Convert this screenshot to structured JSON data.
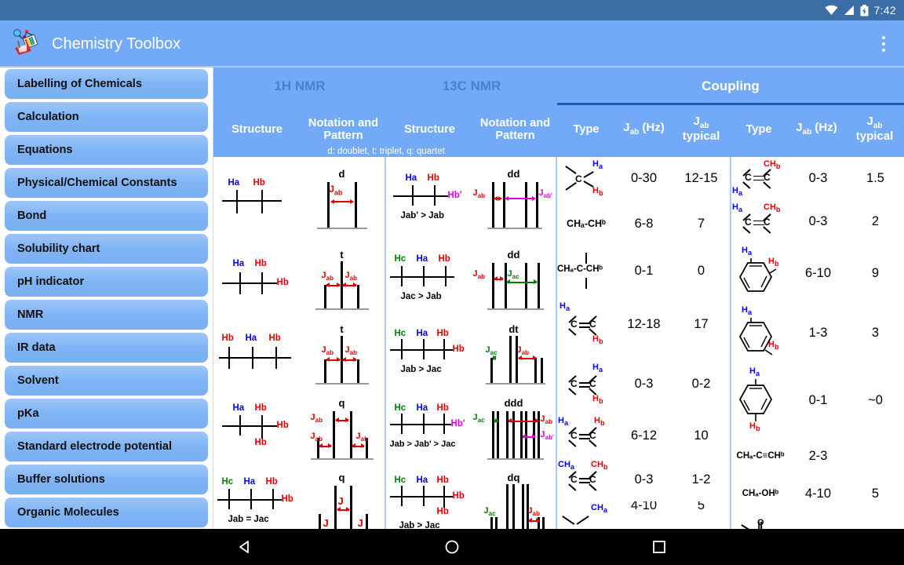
{
  "status_bar": {
    "time": "7:42",
    "icons": [
      "wifi-icon",
      "signal-icon",
      "battery-charging-icon"
    ]
  },
  "app_bar": {
    "title": "Chemistry Toolbox",
    "logo": "chemistry-toolbox-logo",
    "overflow": "overflow-menu-icon"
  },
  "sidebar": {
    "items": [
      {
        "label": "Labelling of Chemicals"
      },
      {
        "label": "Calculation"
      },
      {
        "label": "Equations"
      },
      {
        "label": "Physical/Chemical Constants"
      },
      {
        "label": "Bond"
      },
      {
        "label": "Solubility chart"
      },
      {
        "label": "pH indicator"
      },
      {
        "label": "NMR"
      },
      {
        "label": "IR data"
      },
      {
        "label": "Solvent"
      },
      {
        "label": "pKa"
      },
      {
        "label": "Standard electrode potential"
      },
      {
        "label": "Buffer solutions"
      },
      {
        "label": "Organic Molecules"
      }
    ]
  },
  "tabs": [
    {
      "label": "1H NMR",
      "active": false
    },
    {
      "label": "13C NMR",
      "active": false
    },
    {
      "label": "Coupling",
      "active": true
    }
  ],
  "column_headers": {
    "structure1": "Structure",
    "pattern1_line1": "Notation and",
    "pattern1_line2": "Pattern",
    "structure2": "Structure",
    "pattern2_line1": "Notation and",
    "pattern2_line2": "Pattern",
    "type1": "Type",
    "hz1": "J",
    "hz1_sub": "ab",
    "hz1_unit": " (Hz)",
    "typ1_line1": "J",
    "typ1_sub": "ab",
    "typ1_line2": "typical",
    "type2": "Type",
    "hz2": "J",
    "hz2_sub": "ab",
    "hz2_unit": " (Hz)",
    "typ2_line1": "J",
    "typ2_sub": "ab",
    "typ2_line2": "typical",
    "legend": "d: doublet, t: triplet, q: quartet"
  },
  "nmr_1h_rows": [
    {
      "labels": [
        "Ha",
        "Hb"
      ],
      "extra": "",
      "notation": "d"
    },
    {
      "labels": [
        "Ha",
        "Hb",
        "Hb"
      ],
      "extra": "",
      "notation": "t"
    },
    {
      "labels": [
        "Hb",
        "Ha",
        "Hb"
      ],
      "extra": "",
      "notation": "t"
    },
    {
      "labels": [
        "Ha",
        "Hb",
        "Hb",
        "Hb"
      ],
      "extra": "",
      "notation": "q"
    },
    {
      "labels": [
        "Hc",
        "Ha",
        "Hb",
        "Hb"
      ],
      "extra": "Jab = Jac",
      "notation": "q"
    }
  ],
  "nmr_13c_rows": [
    {
      "labels": [
        "Ha",
        "Hb",
        "Hb'"
      ],
      "extra": "Jab' > Jab",
      "notation": "dd"
    },
    {
      "labels": [
        "Hc",
        "Ha",
        "Hb"
      ],
      "extra": "Jac > Jab",
      "notation": "dd"
    },
    {
      "labels": [
        "Hc",
        "Ha",
        "Hb",
        "Hb"
      ],
      "extra": "Jab > Jac",
      "notation": "dt"
    },
    {
      "labels": [
        "Hc",
        "Ha",
        "Hb",
        "Hb'"
      ],
      "extra": "Jab > Jab' > Jac",
      "notation": "ddd"
    },
    {
      "labels": [
        "Hc",
        "Ha",
        "Hb",
        "Hb",
        "Hb"
      ],
      "extra": "Jab > Jac",
      "notation": "dq"
    }
  ],
  "coupling_left": [
    {
      "type_kind": "geminal-sp3",
      "formula": "",
      "jab": "0-30",
      "typical": "12-15"
    },
    {
      "type_kind": "text",
      "formula": "CHₐ-CHᵇ",
      "jab": "6-8",
      "typical": "7"
    },
    {
      "type_kind": "text-quaternary",
      "formula": "CHₐ-C-CHᵇ",
      "jab": "0-1",
      "typical": "0"
    },
    {
      "type_kind": "alkene-trans",
      "formula": "",
      "jab": "12-18",
      "typical": "17"
    },
    {
      "type_kind": "alkene-geminal",
      "formula": "",
      "jab": "0-3",
      "typical": "0-2"
    },
    {
      "type_kind": "alkene-cis",
      "formula": "",
      "jab": "6-12",
      "typical": "10"
    },
    {
      "type_kind": "alkene-dimethyl",
      "formula": "",
      "jab": "0-3",
      "typical": "1-2"
    },
    {
      "type_kind": "partial",
      "formula": "",
      "jab": "",
      "typical": ""
    }
  ],
  "coupling_right": [
    {
      "type_kind": "allylic-a",
      "formula": "",
      "jab": "0-3",
      "typical": "1.5"
    },
    {
      "type_kind": "allylic-b",
      "formula": "",
      "jab": "0-3",
      "typical": "2"
    },
    {
      "type_kind": "benzene-ortho",
      "formula": "",
      "jab": "6-10",
      "typical": "9"
    },
    {
      "type_kind": "benzene-meta",
      "formula": "",
      "jab": "1-3",
      "typical": "3"
    },
    {
      "type_kind": "benzene-para",
      "formula": "",
      "jab": "0-1",
      "typical": "~0"
    },
    {
      "type_kind": "text",
      "formula": "CHₐ-C≡CHᵇ",
      "jab": "2-3",
      "typical": ""
    },
    {
      "type_kind": "text",
      "formula": "CHₐ-OHᵇ",
      "jab": "4-10",
      "typical": "5"
    },
    {
      "type_kind": "partial",
      "formula": "",
      "jab": "",
      "typical": ""
    }
  ],
  "nav_bar": {
    "back": "back-triangle-icon",
    "home": "home-circle-icon",
    "recents": "recents-square-icon"
  },
  "colors": {
    "appbar": "#73aaf8",
    "statusbar": "#3b6ea5",
    "tab_active_underline": "#1a56c4",
    "tab_inactive_text": "#4a82c8",
    "sidebar_item": "#7fb4f4",
    "label_a": "#0000ee",
    "label_b": "#e00000",
    "label_c": "#008000",
    "label_prime": "#e000e0"
  }
}
